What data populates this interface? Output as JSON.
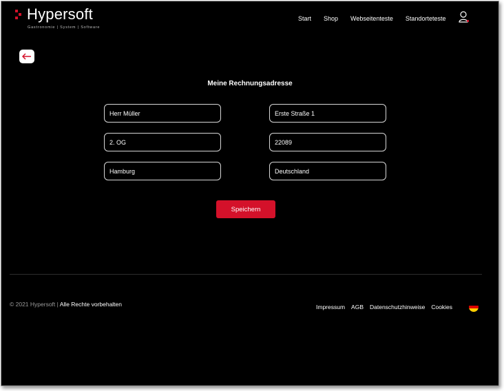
{
  "brand": {
    "name": "Hypersoft",
    "tagline": "Gastronomie | System | Software",
    "accent_color": "#d4112a"
  },
  "nav": {
    "items": [
      {
        "label": "Start"
      },
      {
        "label": "Shop"
      },
      {
        "label": "Webseitenteste"
      },
      {
        "label": "Standorteteste"
      }
    ],
    "user_icon": "user-icon"
  },
  "back_icon": "arrow-left-icon",
  "form": {
    "title": "Meine Rechnungsadresse",
    "fields": {
      "name": "Herr Müller",
      "street": "Erste Straße 1",
      "address_extra": "2. OG",
      "zip": "22089",
      "city": "Hamburg",
      "country": "Deutschland"
    },
    "save_label": "Speichern"
  },
  "footer": {
    "copyright_muted": "© 2021 Hypersoft |",
    "copyright_bright": "Alle Rechte vorbehalten",
    "links": [
      {
        "label": "Impressum"
      },
      {
        "label": "AGB"
      },
      {
        "label": "Datenschutzhinweise"
      },
      {
        "label": "Cookies"
      }
    ],
    "language_icon": "german-flag-icon"
  }
}
